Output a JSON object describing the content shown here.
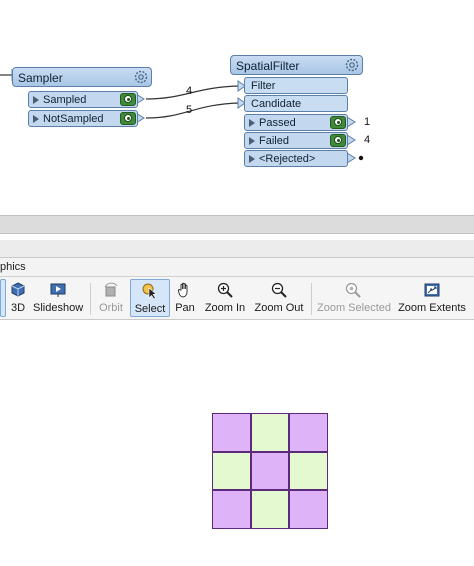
{
  "workspace": {
    "sampler": {
      "title": "Sampler",
      "ports": [
        {
          "label": "Sampled",
          "count": "4"
        },
        {
          "label": "NotSampled",
          "count": "5"
        }
      ]
    },
    "spatial_filter": {
      "title": "SpatialFilter",
      "inputs": [
        {
          "label": "Filter"
        },
        {
          "label": "Candidate"
        }
      ],
      "outputs": [
        {
          "label": "Passed",
          "count": "1"
        },
        {
          "label": "Failed",
          "count": "4"
        },
        {
          "label": "<Rejected>"
        }
      ]
    }
  },
  "panel": {
    "tab_label": "phics"
  },
  "toolbar": {
    "items": [
      {
        "label": "3D",
        "icon": "3d-icon",
        "enabled": true
      },
      {
        "label": "Slideshow",
        "icon": "slideshow-icon",
        "enabled": true
      },
      {
        "label": "Orbit",
        "icon": "orbit-icon",
        "enabled": false
      },
      {
        "label": "Select",
        "icon": "select-icon",
        "enabled": true,
        "active": true
      },
      {
        "label": "Pan",
        "icon": "pan-icon",
        "enabled": true
      },
      {
        "label": "Zoom In",
        "icon": "zoom-in-icon",
        "enabled": true
      },
      {
        "label": "Zoom Out",
        "icon": "zoom-out-icon",
        "enabled": true
      },
      {
        "label": "Zoom Selected",
        "icon": "zoom-selected-icon",
        "enabled": false
      },
      {
        "label": "Zoom Extents",
        "icon": "zoom-extents-icon",
        "enabled": true
      }
    ]
  },
  "colors": {
    "node_header": "#b7cfeb",
    "port_fill": "#c3d8ef",
    "inspector_green": "#3f8a3a",
    "purple_cell": "#deb3f7",
    "green_cell": "#e4f9cf",
    "cell_border": "#5b2a7a"
  },
  "grid_pattern": [
    [
      "purple",
      "green",
      "purple"
    ],
    [
      "green",
      "purple",
      "green"
    ],
    [
      "purple",
      "green",
      "purple"
    ]
  ]
}
